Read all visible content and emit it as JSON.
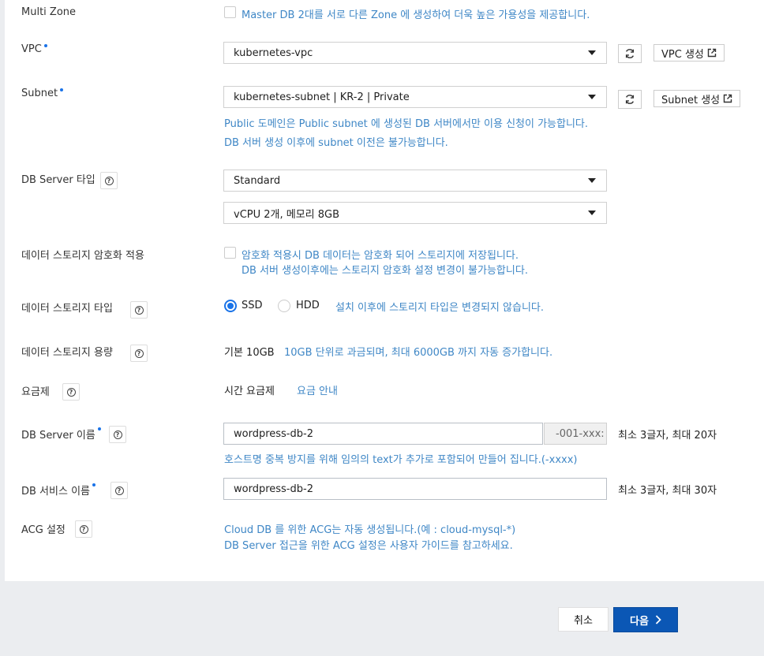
{
  "multi_zone": {
    "label": "Multi Zone",
    "checkbox_text": "Master DB 2대를 서로 다른 Zone 에 생성하여 더욱 높은 가용성을 제공합니다."
  },
  "vpc": {
    "label": "VPC",
    "selected": "kubernetes-vpc",
    "create_label": "VPC 생성"
  },
  "subnet": {
    "label": "Subnet",
    "selected": "kubernetes-subnet | KR-2 | Private",
    "create_label": "Subnet 생성",
    "info_1": "Public 도메인은 Public subnet 에 생성된 DB 서버에서만 이용 신청이 가능합니다.",
    "info_2": "DB 서버 생성 이후에 subnet 이전은 불가능합니다."
  },
  "server_type": {
    "label": "DB Server 타입",
    "type_selected": "Standard",
    "spec_selected": "vCPU 2개, 메모리 8GB"
  },
  "encryption": {
    "label": "데이터 스토리지 암호화 적용",
    "text_1": "암호화 적용시 DB 데이터는 암호화 되어 스토리지에 저장됩니다.",
    "text_2": "DB 서버 생성이후에는 스토리지 암호화 설정 변경이 불가능합니다."
  },
  "storage_type": {
    "label": "데이터 스토리지 타입",
    "option_ssd": "SSD",
    "option_hdd": "HDD",
    "selected": "SSD",
    "info": "설치 이후에 스토리지 타입은 변경되지 않습니다."
  },
  "storage_capacity": {
    "label": "데이터 스토리지 용량",
    "value": "기본 10GB",
    "info": "10GB 단위로 과금되며, 최대 6000GB 까지 자동 증가합니다."
  },
  "pricing": {
    "label": "요금제",
    "value": "시간 요금제",
    "link": "요금 안내"
  },
  "server_name": {
    "label": "DB Server 이름",
    "value": "wordpress-db-2",
    "suffix": "-001-xxx:",
    "rule": "최소 3글자, 최대 20자",
    "info": "호스트명 중복 방지를 위해 임의의 text가 추가로 포함되어 만들어 집니다.(-xxxx)"
  },
  "service_name": {
    "label": "DB 서비스 이름",
    "value": "wordpress-db-2",
    "rule": "최소 3글자, 최대 30자"
  },
  "acg": {
    "label": "ACG 설정",
    "info_1": "Cloud DB 를 위한 ACG는 자동 생성됩니다.(예 : cloud-mysql-*)",
    "info_2": "DB Server 접근을 위한 ACG 설정은 사용자 가이드를 참고하세요."
  },
  "footer": {
    "cancel": "취소",
    "next": "다음"
  },
  "colors": {
    "accent": "#0b57b5",
    "info_text": "#3f87c6",
    "required_dot": "#1a73e8"
  }
}
